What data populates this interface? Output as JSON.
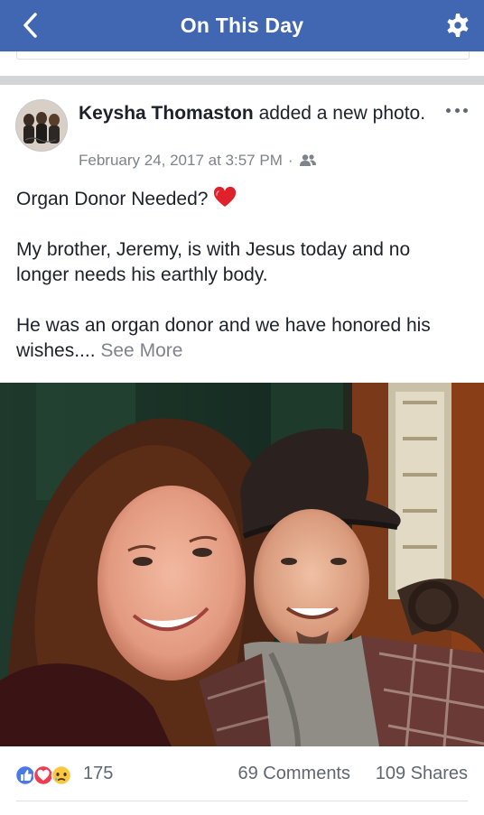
{
  "navbar": {
    "title": "On This Day",
    "back_icon": "chevron-left-icon",
    "settings_icon": "gear-icon",
    "bg_color": "#4267b2"
  },
  "post": {
    "author": "Keysha Thomaston",
    "action": "added a new photo.",
    "date": "February 24, 2017 at 3:57 PM",
    "separator": "·",
    "audience_icon": "friends-icon",
    "more_icon": "more-options-icon",
    "text": {
      "line1": "Organ Donor Needed? ",
      "heart_icon": "red-heart-emoji",
      "para2": "My brother, Jeremy, is with Jesus today and no longer needs his earthly body.",
      "para3": "He was an organ donor and we have honored his wishes.... ",
      "see_more": "See More"
    },
    "photo": {
      "description_icon": "photo-two-people-selfie"
    },
    "engagement": {
      "reactions_count": "175",
      "reaction_icons": [
        "like-reaction-icon",
        "love-reaction-icon",
        "sad-reaction-icon"
      ],
      "comments": "69 Comments",
      "shares": "109 Shares"
    }
  }
}
